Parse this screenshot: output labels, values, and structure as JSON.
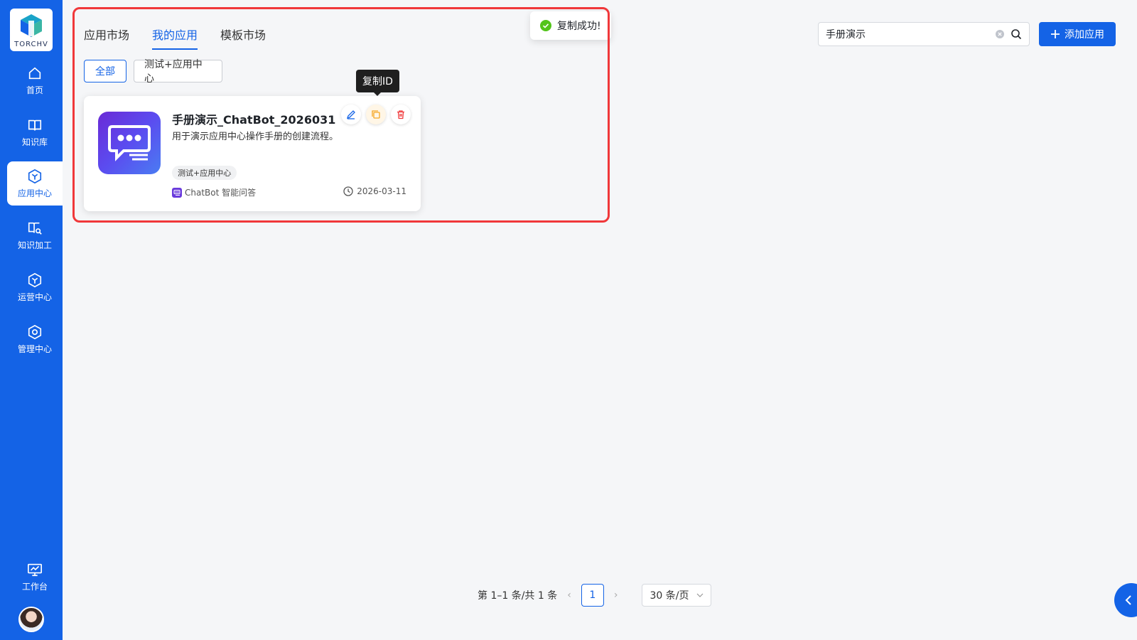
{
  "brand": {
    "logo_text": "TORCHV",
    "accent": "#1463e6"
  },
  "sidebar": {
    "items": [
      {
        "label": "首页",
        "icon": "home-icon"
      },
      {
        "label": "知识库",
        "icon": "book-icon"
      },
      {
        "label": "应用中心",
        "icon": "app-center-icon",
        "active": true
      },
      {
        "label": "知识加工",
        "icon": "knowledge-process-icon"
      },
      {
        "label": "运营中心",
        "icon": "operations-icon"
      },
      {
        "label": "管理中心",
        "icon": "settings-icon"
      }
    ],
    "workbench_label": "工作台"
  },
  "tabs": [
    "应用市场",
    "我的应用",
    "模板市场"
  ],
  "active_tab": "我的应用",
  "filters": [
    "全部",
    "测试+应用中心"
  ],
  "toast": {
    "text": "复制成功!",
    "status_color": "#52c41a"
  },
  "tooltip": {
    "text": "复制ID"
  },
  "search": {
    "value": "手册演示"
  },
  "add_button": {
    "label": "添加应用"
  },
  "card": {
    "title": "手册演示_ChatBot_2026031",
    "description": "用于演示应用中心操作手册的创建流程。",
    "tag": "测试+应用中心",
    "type": "ChatBot 智能问答",
    "date": "2026-03-11"
  },
  "pagination": {
    "summary": "第 1–1 条/共 1 条",
    "current_page": "1",
    "page_size": "30 条/页"
  }
}
